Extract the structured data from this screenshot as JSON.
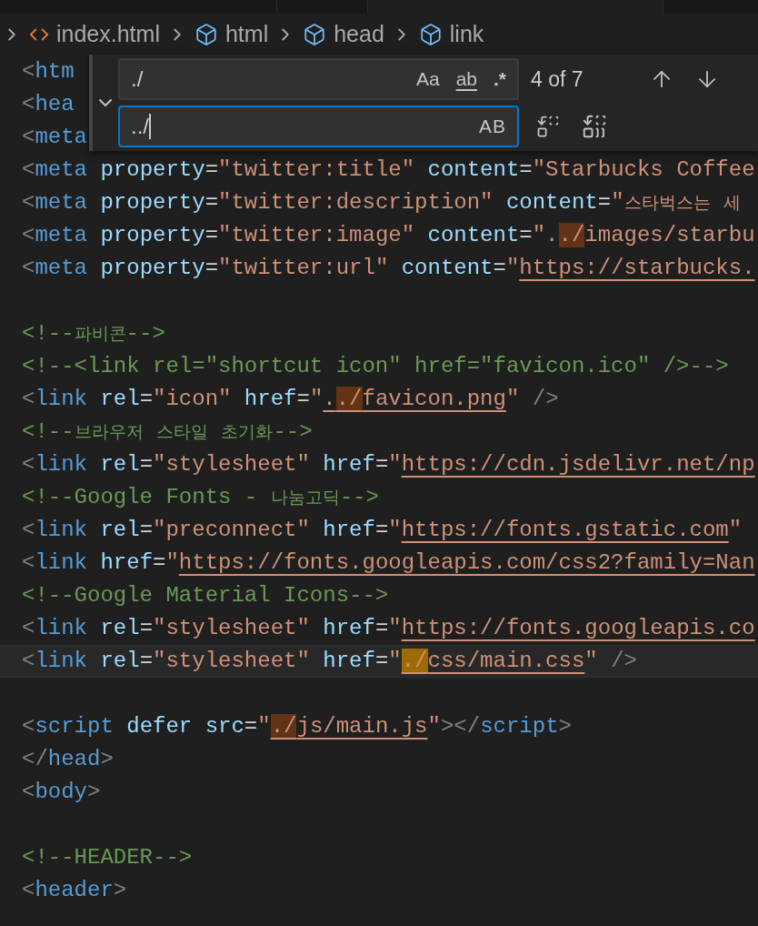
{
  "breadcrumb": [
    {
      "label": "index.html",
      "kind": "file"
    },
    {
      "label": "html",
      "kind": "element"
    },
    {
      "label": "head",
      "kind": "element"
    },
    {
      "label": "link",
      "kind": "element"
    }
  ],
  "find_widget": {
    "expanded": true,
    "find": {
      "value": "./",
      "focused": false,
      "options": [
        {
          "kind": "case",
          "label": "Aa",
          "on": false
        },
        {
          "kind": "word",
          "label": "ab",
          "on": false
        },
        {
          "kind": "regex",
          "label": ".*",
          "on": false
        }
      ]
    },
    "count": "4 of 7",
    "replace": {
      "value": "../",
      "focused": true,
      "options": [
        {
          "kind": "preserve-case",
          "label": "AB",
          "on": false
        }
      ]
    }
  },
  "lines": [
    {
      "kind": "code",
      "tokens": [
        {
          "kind": "punct",
          "text": "<"
        },
        {
          "kind": "tag",
          "text": "htm"
        }
      ]
    },
    {
      "kind": "code",
      "tokens": [
        {
          "kind": "punct",
          "text": "<"
        },
        {
          "kind": "tag",
          "text": "hea"
        }
      ]
    },
    {
      "kind": "code",
      "tokens": [
        {
          "kind": "punct",
          "text": "<"
        },
        {
          "kind": "tag",
          "text": "meta"
        }
      ]
    },
    {
      "kind": "code",
      "tokens": [
        {
          "kind": "punct",
          "text": "<"
        },
        {
          "kind": "tag",
          "text": "meta"
        },
        {
          "kind": "attr",
          "text": " property"
        },
        {
          "kind": "plain",
          "text": "="
        },
        {
          "kind": "string",
          "text": "\"twitter:title\""
        },
        {
          "kind": "attr",
          "text": " content"
        },
        {
          "kind": "plain",
          "text": "="
        },
        {
          "kind": "string",
          "text": "\"Starbucks Coffee"
        }
      ]
    },
    {
      "kind": "code",
      "tokens": [
        {
          "kind": "punct",
          "text": "<"
        },
        {
          "kind": "tag",
          "text": "meta"
        },
        {
          "kind": "attr",
          "text": " property"
        },
        {
          "kind": "plain",
          "text": "="
        },
        {
          "kind": "string",
          "text": "\"twitter:description\""
        },
        {
          "kind": "attr",
          "text": " content"
        },
        {
          "kind": "plain",
          "text": "="
        },
        {
          "kind": "string",
          "text": "\"스타벅스는 세"
        }
      ]
    },
    {
      "kind": "code",
      "tokens": [
        {
          "kind": "punct",
          "text": "<"
        },
        {
          "kind": "tag",
          "text": "meta"
        },
        {
          "kind": "attr",
          "text": " property"
        },
        {
          "kind": "plain",
          "text": "="
        },
        {
          "kind": "string",
          "text": "\"twitter:image\""
        },
        {
          "kind": "attr",
          "text": " content"
        },
        {
          "kind": "plain",
          "text": "="
        },
        {
          "kind": "string",
          "text": "\"."
        },
        {
          "kind": "string",
          "text": "./",
          "match": true,
          "selected": false
        },
        {
          "kind": "string",
          "text": "images/starbu"
        }
      ]
    },
    {
      "kind": "code",
      "tokens": [
        {
          "kind": "punct",
          "text": "<"
        },
        {
          "kind": "tag",
          "text": "meta"
        },
        {
          "kind": "attr",
          "text": " property"
        },
        {
          "kind": "plain",
          "text": "="
        },
        {
          "kind": "string",
          "text": "\"twitter:url\""
        },
        {
          "kind": "attr",
          "text": " content"
        },
        {
          "kind": "plain",
          "text": "="
        },
        {
          "kind": "string",
          "text": "\""
        },
        {
          "kind": "string",
          "text": "https://starbucks.",
          "link": true
        }
      ]
    },
    {
      "kind": "blank"
    },
    {
      "kind": "code",
      "tokens": [
        {
          "kind": "comment",
          "text": "<!--파비콘-->"
        }
      ]
    },
    {
      "kind": "code",
      "tokens": [
        {
          "kind": "comment",
          "text": "<!--<link rel=\"shortcut icon\" href=\"favicon.ico\" />-->"
        }
      ]
    },
    {
      "kind": "code",
      "tokens": [
        {
          "kind": "punct",
          "text": "<"
        },
        {
          "kind": "tag",
          "text": "link"
        },
        {
          "kind": "attr",
          "text": " rel"
        },
        {
          "kind": "plain",
          "text": "="
        },
        {
          "kind": "string",
          "text": "\"icon\""
        },
        {
          "kind": "attr",
          "text": " href"
        },
        {
          "kind": "plain",
          "text": "="
        },
        {
          "kind": "string",
          "text": "\""
        },
        {
          "kind": "string",
          "text": ".",
          "link": true
        },
        {
          "kind": "string",
          "text": "./",
          "link": true,
          "match": true,
          "selected": false
        },
        {
          "kind": "string",
          "text": "favicon.png",
          "link": true
        },
        {
          "kind": "string",
          "text": "\""
        },
        {
          "kind": "punct",
          "text": " />"
        }
      ]
    },
    {
      "kind": "code",
      "tokens": [
        {
          "kind": "comment",
          "text": "<!--브라우저 스타일 초기화-->"
        }
      ]
    },
    {
      "kind": "code",
      "tokens": [
        {
          "kind": "punct",
          "text": "<"
        },
        {
          "kind": "tag",
          "text": "link"
        },
        {
          "kind": "attr",
          "text": " rel"
        },
        {
          "kind": "plain",
          "text": "="
        },
        {
          "kind": "string",
          "text": "\"stylesheet\""
        },
        {
          "kind": "attr",
          "text": " href"
        },
        {
          "kind": "plain",
          "text": "="
        },
        {
          "kind": "string",
          "text": "\""
        },
        {
          "kind": "string",
          "text": "https://cdn.jsdelivr.net/np",
          "link": true
        }
      ]
    },
    {
      "kind": "code",
      "tokens": [
        {
          "kind": "comment",
          "text": "<!--Google Fonts - 나눔고딕-->"
        }
      ]
    },
    {
      "kind": "code",
      "tokens": [
        {
          "kind": "punct",
          "text": "<"
        },
        {
          "kind": "tag",
          "text": "link"
        },
        {
          "kind": "attr",
          "text": " rel"
        },
        {
          "kind": "plain",
          "text": "="
        },
        {
          "kind": "string",
          "text": "\"preconnect\""
        },
        {
          "kind": "attr",
          "text": " href"
        },
        {
          "kind": "plain",
          "text": "="
        },
        {
          "kind": "string",
          "text": "\""
        },
        {
          "kind": "string",
          "text": "https://fonts.gstatic.com",
          "link": true
        },
        {
          "kind": "string",
          "text": "\""
        }
      ]
    },
    {
      "kind": "code",
      "tokens": [
        {
          "kind": "punct",
          "text": "<"
        },
        {
          "kind": "tag",
          "text": "link"
        },
        {
          "kind": "attr",
          "text": " href"
        },
        {
          "kind": "plain",
          "text": "="
        },
        {
          "kind": "string",
          "text": "\""
        },
        {
          "kind": "string",
          "text": "https://fonts.googleapis.com/css2?family=Nan",
          "link": true
        }
      ]
    },
    {
      "kind": "code",
      "tokens": [
        {
          "kind": "comment",
          "text": "<!--Google Material Icons-->"
        }
      ]
    },
    {
      "kind": "code",
      "tokens": [
        {
          "kind": "punct",
          "text": "<"
        },
        {
          "kind": "tag",
          "text": "link"
        },
        {
          "kind": "attr",
          "text": " rel"
        },
        {
          "kind": "plain",
          "text": "="
        },
        {
          "kind": "string",
          "text": "\"stylesheet\""
        },
        {
          "kind": "attr",
          "text": " href"
        },
        {
          "kind": "plain",
          "text": "="
        },
        {
          "kind": "string",
          "text": "\""
        },
        {
          "kind": "string",
          "text": "https://fonts.googleapis.co",
          "link": true
        }
      ]
    },
    {
      "kind": "code",
      "current": true,
      "tokens": [
        {
          "kind": "punct",
          "text": "<"
        },
        {
          "kind": "tag",
          "text": "link"
        },
        {
          "kind": "attr",
          "text": " rel"
        },
        {
          "kind": "plain",
          "text": "="
        },
        {
          "kind": "string",
          "text": "\"stylesheet\""
        },
        {
          "kind": "attr",
          "text": " href"
        },
        {
          "kind": "plain",
          "text": "="
        },
        {
          "kind": "string",
          "text": "\""
        },
        {
          "kind": "string",
          "text": "./",
          "link": true,
          "match": true,
          "selected": true
        },
        {
          "kind": "string",
          "text": "css/main.css",
          "link": true
        },
        {
          "kind": "string",
          "text": "\""
        },
        {
          "kind": "punct",
          "text": " />"
        }
      ]
    },
    {
      "kind": "blank"
    },
    {
      "kind": "code",
      "tokens": [
        {
          "kind": "punct",
          "text": "<"
        },
        {
          "kind": "tag",
          "text": "script"
        },
        {
          "kind": "attr",
          "text": " defer"
        },
        {
          "kind": "attr",
          "text": " src"
        },
        {
          "kind": "plain",
          "text": "="
        },
        {
          "kind": "string",
          "text": "\""
        },
        {
          "kind": "string",
          "text": "./",
          "link": true,
          "match": true,
          "selected": false
        },
        {
          "kind": "string",
          "text": "js/main.js",
          "link": true
        },
        {
          "kind": "string",
          "text": "\""
        },
        {
          "kind": "punct",
          "text": "></"
        },
        {
          "kind": "tag",
          "text": "script"
        },
        {
          "kind": "punct",
          "text": ">"
        }
      ]
    },
    {
      "kind": "code",
      "tokens": [
        {
          "kind": "punct",
          "text": "</"
        },
        {
          "kind": "tag",
          "text": "head"
        },
        {
          "kind": "punct",
          "text": ">"
        }
      ]
    },
    {
      "kind": "code",
      "tokens": [
        {
          "kind": "punct",
          "text": "<"
        },
        {
          "kind": "tag",
          "text": "body"
        },
        {
          "kind": "punct",
          "text": ">"
        }
      ]
    },
    {
      "kind": "blank"
    },
    {
      "kind": "code",
      "tokens": [
        {
          "kind": "comment",
          "text": "<!--HEADER-->"
        }
      ]
    },
    {
      "kind": "code",
      "tokens": [
        {
          "kind": "punct",
          "text": "<"
        },
        {
          "kind": "tag",
          "text": "header"
        },
        {
          "kind": "punct",
          "text": ">"
        }
      ]
    }
  ]
}
